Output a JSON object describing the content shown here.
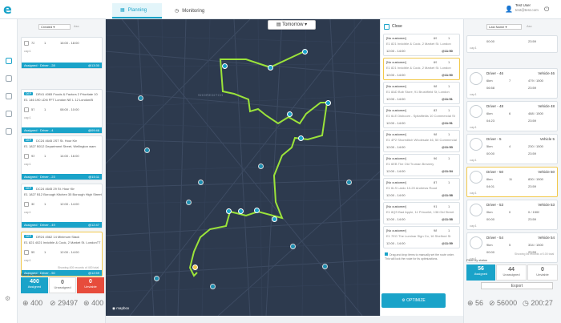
{
  "topbar": {
    "logo": "e",
    "tabs": [
      {
        "label": "Planning"
      },
      {
        "label": "Monitoring"
      }
    ],
    "user": {
      "name": "Test User",
      "email": "test@test.com"
    }
  },
  "left": {
    "filter": {
      "sort": "Created",
      "order": "Asc"
    },
    "cards": [
      {
        "id": "",
        "addr": "",
        "n1": "72",
        "n2": "1",
        "time": "16:00 - 18:00",
        "status": "Assigned",
        "driver": "Driver - 28",
        "eta": "@13:30"
      },
      {
        "id": "DEP",
        "addr": "DR41 4065 Foods & Factors 2 Prioritate 10",
        "addr2": "E1 146 190 LDN FFT London NE L 12 London/B",
        "n1": "57",
        "n2": "1",
        "time": "08:00 - 10:00",
        "status": "Assigned",
        "driver": "Driver - 4",
        "eta": "@09:46"
      },
      {
        "id": "DEP",
        "addr": "DC24 4645 2ST St. Hour Kin",
        "addr2": "E1 1827 B012 Department Street, Wellington wam",
        "n1": "93",
        "n2": "1",
        "time": "14:00 - 16:00",
        "status": "Assigned",
        "driver": "Driver - 23",
        "eta": "@15:11"
      },
      {
        "id": "DEP",
        "addr": "DC24 4645 29 St. Hour Kin",
        "addr2": "E1 1827 B12 Borough Kitchen 35 Borough High Street",
        "n1": "30",
        "n2": "1",
        "time": "12:00 - 14:00",
        "status": "Assigned",
        "driver": "Driver - 49",
        "eta": "@12:47"
      },
      {
        "id": "DEP",
        "addr": "DR24 4562 14 Minimum Stack",
        "addr2": "E1 821 4021 Invicible & Cook, 2 Market St. LondonTT",
        "n1": "55",
        "n2": "1",
        "time": "12:00 - 14:00",
        "status": "Assigned",
        "driver": "Driver - 50",
        "eta": "@12:59"
      }
    ],
    "count_text": "Showing 400 records of 400 total",
    "filter_label": "Filter by status",
    "status": [
      {
        "value": "400",
        "label": "Assigned"
      },
      {
        "value": "0",
        "label": "Unassigned"
      },
      {
        "value": "0",
        "label": "Unviable"
      }
    ],
    "footer": {
      "a": "400",
      "b": "29497",
      "c": "400"
    }
  },
  "map": {
    "date_label": "Tomorrow",
    "attribution": "mapbox",
    "credit": "© Mapbox © OpenStreetMap Improve this map",
    "area_label": "SHOREDITCH"
  },
  "center": {
    "close_label": "Close",
    "cards": [
      {
        "title": "[No customer]",
        "addr": "E1 821 Invicible & Cook, 2 Market St. London",
        "n1": "69",
        "n2": "1",
        "time": "12:00 - 14:00",
        "eta": "@11:50"
      },
      {
        "title": "[No customer]",
        "addr": "E1 821 Invicible & Cook, 2 Market St. London",
        "n1": "69",
        "n2": "1",
        "time": "12:00 - 14:00",
        "eta": "@11:50"
      },
      {
        "title": "[No customer]",
        "addr": "E1 8AD Bob Store, 91 Brushfield St, London",
        "n1": "98",
        "n2": "1",
        "time": "12:00 - 14:00",
        "eta": "@11:51"
      },
      {
        "title": "[No customer]",
        "addr": "E1 6LE Dishoom - Spitalfields 10 Commercial St",
        "n1": "83",
        "n2": "1",
        "time": "12:00 - 14:00",
        "eta": "@11:51"
      },
      {
        "title": "[No customer]",
        "addr": "E1 4P2 Shoreditch Wholesale 46, 50 Commercial",
        "n1": "98",
        "n2": "1",
        "time": "12:00 - 14:00",
        "eta": "@11:53"
      },
      {
        "title": "[No customer]",
        "addr": "E1 6EB The Old Truman Brewery",
        "n1": "96",
        "n2": "1",
        "time": "12:00 - 14:00",
        "eta": "@11:54"
      },
      {
        "title": "[No customer]",
        "addr": "E1 6LS Lardo 10-20 Andrews Road",
        "n1": "87",
        "n2": "1",
        "time": "12:00 - 14:00",
        "eta": "@11:58"
      },
      {
        "title": "[No customer]",
        "addr": "E1 8QS Bad Apple, 11 Princelet, 138 Old Street",
        "n1": "91",
        "n2": "1",
        "time": "12:00 - 14:00",
        "eta": "@11:58"
      },
      {
        "title": "[No customer]",
        "addr": "E1 7EG The Luminar Sign Co, 16 Shelford St",
        "n1": "98",
        "n2": "1",
        "time": "12:00 - 14:00",
        "eta": "@11:59"
      }
    ],
    "note": "Drag and drop items to manually set the route order. This will lock the route for its optimizations.",
    "optimize_label": "OPTIMIZE"
  },
  "right": {
    "filter": {
      "sort": "Last Name",
      "order": "Asc"
    },
    "drivers": [
      {
        "name": "",
        "vehicle": "",
        "km": "",
        "stops": "",
        "cap": "",
        "time": "00:00",
        "dur": "23:59",
        "tag": "cap1"
      },
      {
        "name": "Driver - 46",
        "vehicle": "Vehicle 46",
        "km": "6km",
        "stops": "7",
        "cap": "479 / 1500",
        "time": "06:58",
        "dur": "23:59",
        "tag": "cap1"
      },
      {
        "name": "Driver - 48",
        "vehicle": "Vehicle 48",
        "km": "6km",
        "stops": "6",
        "cap": "488 / 1500",
        "time": "04:23",
        "dur": "23:59",
        "tag": "cap1"
      },
      {
        "name": "Driver - 5",
        "vehicle": "Vehicle 5",
        "km": "5km",
        "stops": "4",
        "cap": "230 / 1500",
        "time": "00:00",
        "dur": "23:59",
        "tag": "cap1"
      },
      {
        "name": "Driver - 50",
        "vehicle": "Vehicle 50",
        "km": "6km",
        "stops": "11",
        "cap": "830 / 1500",
        "time": "04:01",
        "dur": "23:59",
        "tag": "cap1"
      },
      {
        "name": "Driver - 53",
        "vehicle": "Vehicle 53",
        "km": "0km",
        "stops": "0",
        "cap": "0 / 1500",
        "time": "00:00",
        "dur": "23:59",
        "tag": "cap1"
      },
      {
        "name": "Driver - 54",
        "vehicle": "Vehicle 54",
        "km": "9km",
        "stops": "5",
        "cap": "334 / 1500",
        "time": "00:00",
        "dur": "23:59",
        "tag": "cap1"
      }
    ],
    "count_text": "Showing 56 records of 100 total",
    "filter_label": "Filter by status",
    "status": [
      {
        "value": "56",
        "label": "Assigned"
      },
      {
        "value": "44",
        "label": "Unassigned"
      },
      {
        "value": "0",
        "label": "Unviable"
      }
    ],
    "export_label": "Export",
    "footer": {
      "a": "56",
      "b": "56000",
      "c": "200:27"
    }
  },
  "colors": {
    "accent": "#1aa3c9",
    "route": "#9be33a",
    "map_bg": "#2d3a4e",
    "selected": "#f2c94c",
    "unviable": "#e74c3c"
  }
}
